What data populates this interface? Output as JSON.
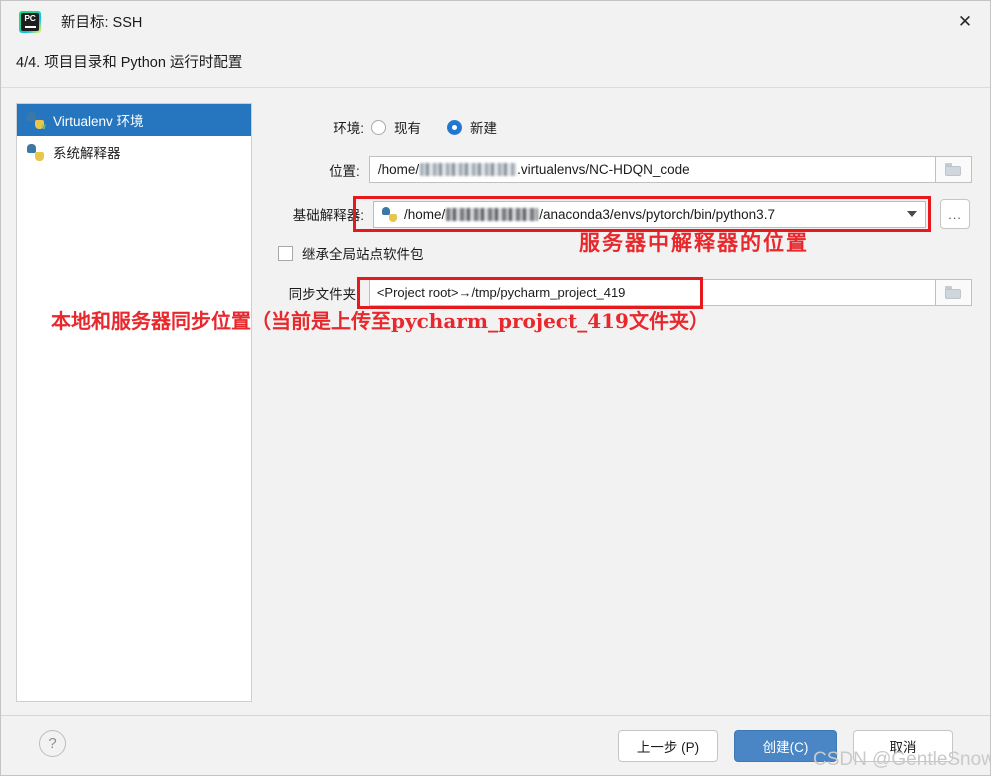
{
  "window": {
    "title": "新目标: SSH",
    "app_icon": "pycharm-icon",
    "close_icon": "close-icon"
  },
  "step_header": "4/4. 项目目录和 Python 运行时配置",
  "sidebar": {
    "items": [
      {
        "label": "Virtualenv 环境",
        "icon": "python-venv-icon",
        "selected": true
      },
      {
        "label": "系统解释器",
        "icon": "python-icon",
        "selected": false
      }
    ]
  },
  "form": {
    "environment": {
      "label": "环境:",
      "options": [
        {
          "label": "现有",
          "selected": false
        },
        {
          "label": "新建",
          "selected": true
        }
      ]
    },
    "location": {
      "label": "位置:",
      "value_prefix": "/home/",
      "value_suffix": ".virtualenvs/NC-HDQN_code",
      "browse_icon": "folder-icon"
    },
    "base_interpreter": {
      "label": "基础解释器:",
      "value_prefix": "/home/",
      "value_suffix": "/anaconda3/envs/pytorch/bin/python3.7",
      "icon": "python-icon",
      "dropdown_icon": "chevron-down-icon",
      "more_button": "..."
    },
    "inherit_global": {
      "label": "继承全局站点软件包",
      "checked": false
    },
    "sync_folders": {
      "label": "同步文件夹:",
      "value": "<Project root>→/tmp/pycharm_project_419",
      "browse_icon": "folder-icon"
    }
  },
  "annotations": [
    {
      "text": "服务器中解释器的位置"
    },
    {
      "text": "本地和服务器同步位置（当前是上传至pycharm_project_419文件夹）"
    }
  ],
  "footer": {
    "help_icon": "?",
    "back_button": "上一步 (P)",
    "create_button": "创建(C)",
    "cancel_button": "取消"
  },
  "watermark": "CSDN @GentleSnow_",
  "colors": {
    "accent": "#2675bf",
    "primary_button": "#4a86c5",
    "annotation_red": "#e8282c",
    "highlight_red": "#e8191c"
  }
}
